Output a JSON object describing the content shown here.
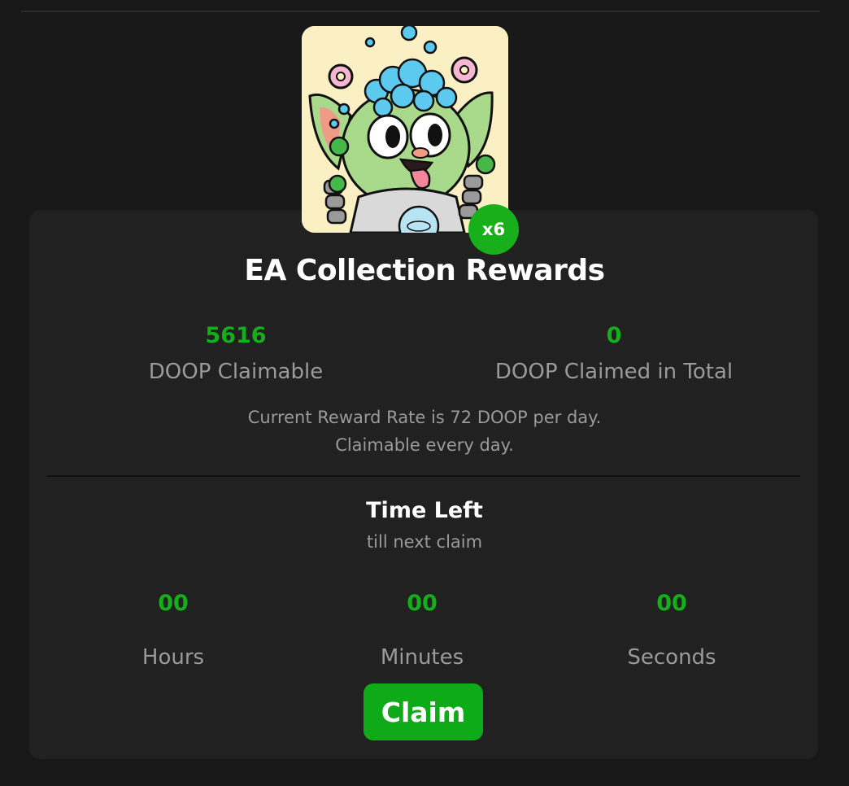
{
  "reward": {
    "multiplier": "x6",
    "title": "EA Collection Rewards",
    "claimable": {
      "value": "5616",
      "label": "DOOP Claimable"
    },
    "claimed": {
      "value": "0",
      "label": "DOOP Claimed in Total"
    },
    "rate_line": "Current Reward Rate is 72 DOOP per day.",
    "frequency_line": "Claimable every day."
  },
  "timer": {
    "title": "Time Left",
    "subtitle": "till next claim",
    "units": [
      {
        "value": "00",
        "label": "Hours"
      },
      {
        "value": "00",
        "label": "Minutes"
      },
      {
        "value": "00",
        "label": "Seconds"
      }
    ]
  },
  "actions": {
    "claim_label": "Claim"
  },
  "colors": {
    "background": "#181818",
    "card": "#212121",
    "accent_green": "#13b01a",
    "muted_text": "#9a9a9a",
    "nft_background": "#fbf0c4"
  },
  "icons": {
    "nft": "nft-creature-image"
  }
}
